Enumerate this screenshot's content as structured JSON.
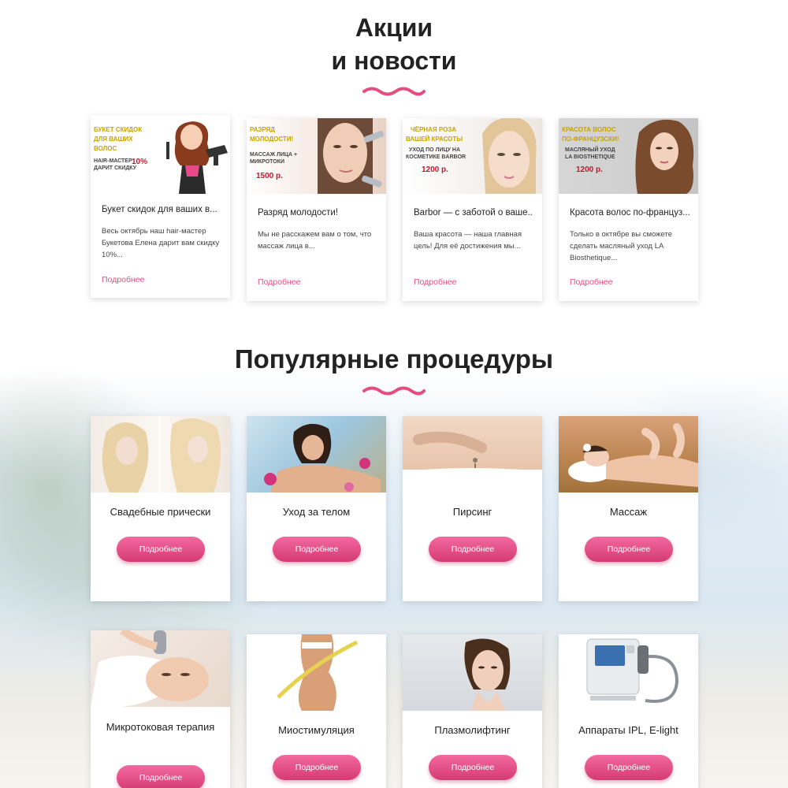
{
  "news_section": {
    "title_line1": "Акции",
    "title_line2": "и новости",
    "cards": [
      {
        "image_text": {
          "line1": "БУКЕТ СКИДОК",
          "line2": "ДЛЯ ВАШИХ",
          "line3": "ВОЛОС",
          "sub1": "HAIR-МАСТЕР",
          "sub2": "ДАРИТ СКИДКУ",
          "price": "10%"
        },
        "title": "Букет скидок для ваших в...",
        "text": "Весь октябрь наш hair-мастер Букетова Елена дарит вам скидку 10%...",
        "more": "Подробнее"
      },
      {
        "image_text": {
          "line1": "РАЗРЯД",
          "line2": "МОЛОДОСТИ!",
          "sub1": "МАССАЖ ЛИЦА +",
          "sub2": "МИКРОТОКИ",
          "price": "1500 р."
        },
        "title": "Разряд молодости!",
        "text": "Мы не расскажем вам о том, что массаж лица в...",
        "more": "Подробнее"
      },
      {
        "image_text": {
          "line1": "ЧЁРНАЯ РОЗА",
          "line2": "ВАШЕЙ КРАСОТЫ",
          "sub1": "УХОД ПО ЛИЦУ НА",
          "sub2": "КОСМЕТИКЕ BARBOR",
          "price": "1200 р."
        },
        "title": "Barbor — с заботой о ваше...",
        "text": "Ваша красота — наша главная цель! Для её достижения мы...",
        "more": "Подробнее"
      },
      {
        "image_text": {
          "line1": "КРАСОТА ВОЛОС",
          "line2": "ПО-ФРАНЦУЗСКИ!",
          "sub1": "МАСЛЯНЫЙ УХОД",
          "sub2": "LA BIOSTHETIQUE",
          "price": "1200 р."
        },
        "title": "Красота волос по-француз...",
        "text": "Только в октябре вы сможете сделать масляный уход LA Biosthetique...",
        "more": "Подробнее"
      }
    ]
  },
  "procedures_section": {
    "title": "Популярные процедуры",
    "items": [
      {
        "name": "Свадебные прически",
        "button": "Подробнее"
      },
      {
        "name": "Уход за телом",
        "button": "Подробнее"
      },
      {
        "name": "Пирсинг",
        "button": "Подробнее"
      },
      {
        "name": "Массаж",
        "button": "Подробнее"
      },
      {
        "name": "Микротоковая терапия",
        "button": "Подробнее"
      },
      {
        "name": "Миостимуляция",
        "button": "Подробнее"
      },
      {
        "name": "Плазмолифтинг",
        "button": "Подробнее"
      },
      {
        "name": "Аппараты IPL, E-light",
        "button": "Подробнее"
      }
    ]
  },
  "colors": {
    "accent": "#e64d7e",
    "button": "#e0457f",
    "title": "#222222",
    "promo_yellow": "#c8a300",
    "promo_red": "#c0182b"
  }
}
